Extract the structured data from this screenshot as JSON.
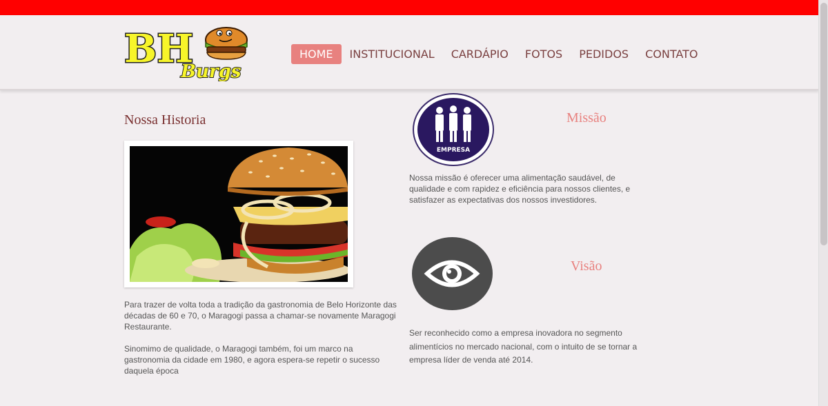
{
  "logo": {
    "text": "BH Burgs",
    "alt": "BH Burgs logo"
  },
  "nav": {
    "items": [
      {
        "label": "HOME",
        "active": true
      },
      {
        "label": "INSTITUCIONAL",
        "active": false
      },
      {
        "label": "CARDÁPIO",
        "active": false
      },
      {
        "label": "FOTOS",
        "active": false
      },
      {
        "label": "PEDIDOS",
        "active": false
      },
      {
        "label": "CONTATO",
        "active": false
      }
    ]
  },
  "history": {
    "title": "Nossa Historia",
    "paragraph1": "Para trazer de volta toda a tradição da gastronomia de Belo Horizonte das décadas de 60 e 70, o Maragogi passa a chamar-se novamente Maragogi Restaurante.",
    "paragraph2": "Sinomimo de qualidade, o Maragogi também, foi um marco na gastronomia da cidade em 1980, e agora espera-se repetir o sucesso daquela época"
  },
  "missao": {
    "title": "Missão",
    "badge_text": "EMPRESA",
    "text": "Nossa missão é oferecer uma alimentação saudável, de qualidade e com rapidez e eficiência para nossos clientes, e satisfazer as expectativas dos nossos investidores."
  },
  "visao": {
    "title": "Visão",
    "text": "Ser reconhecido como a empresa inovadora no segmento alimentícios no mercado nacional, com o intuito de se tornar a empresa líder de venda até 2014."
  },
  "colors": {
    "top_bar": "#ff0000",
    "accent": "#e8817f",
    "title": "#7a3030",
    "background": "#f2eef0"
  }
}
